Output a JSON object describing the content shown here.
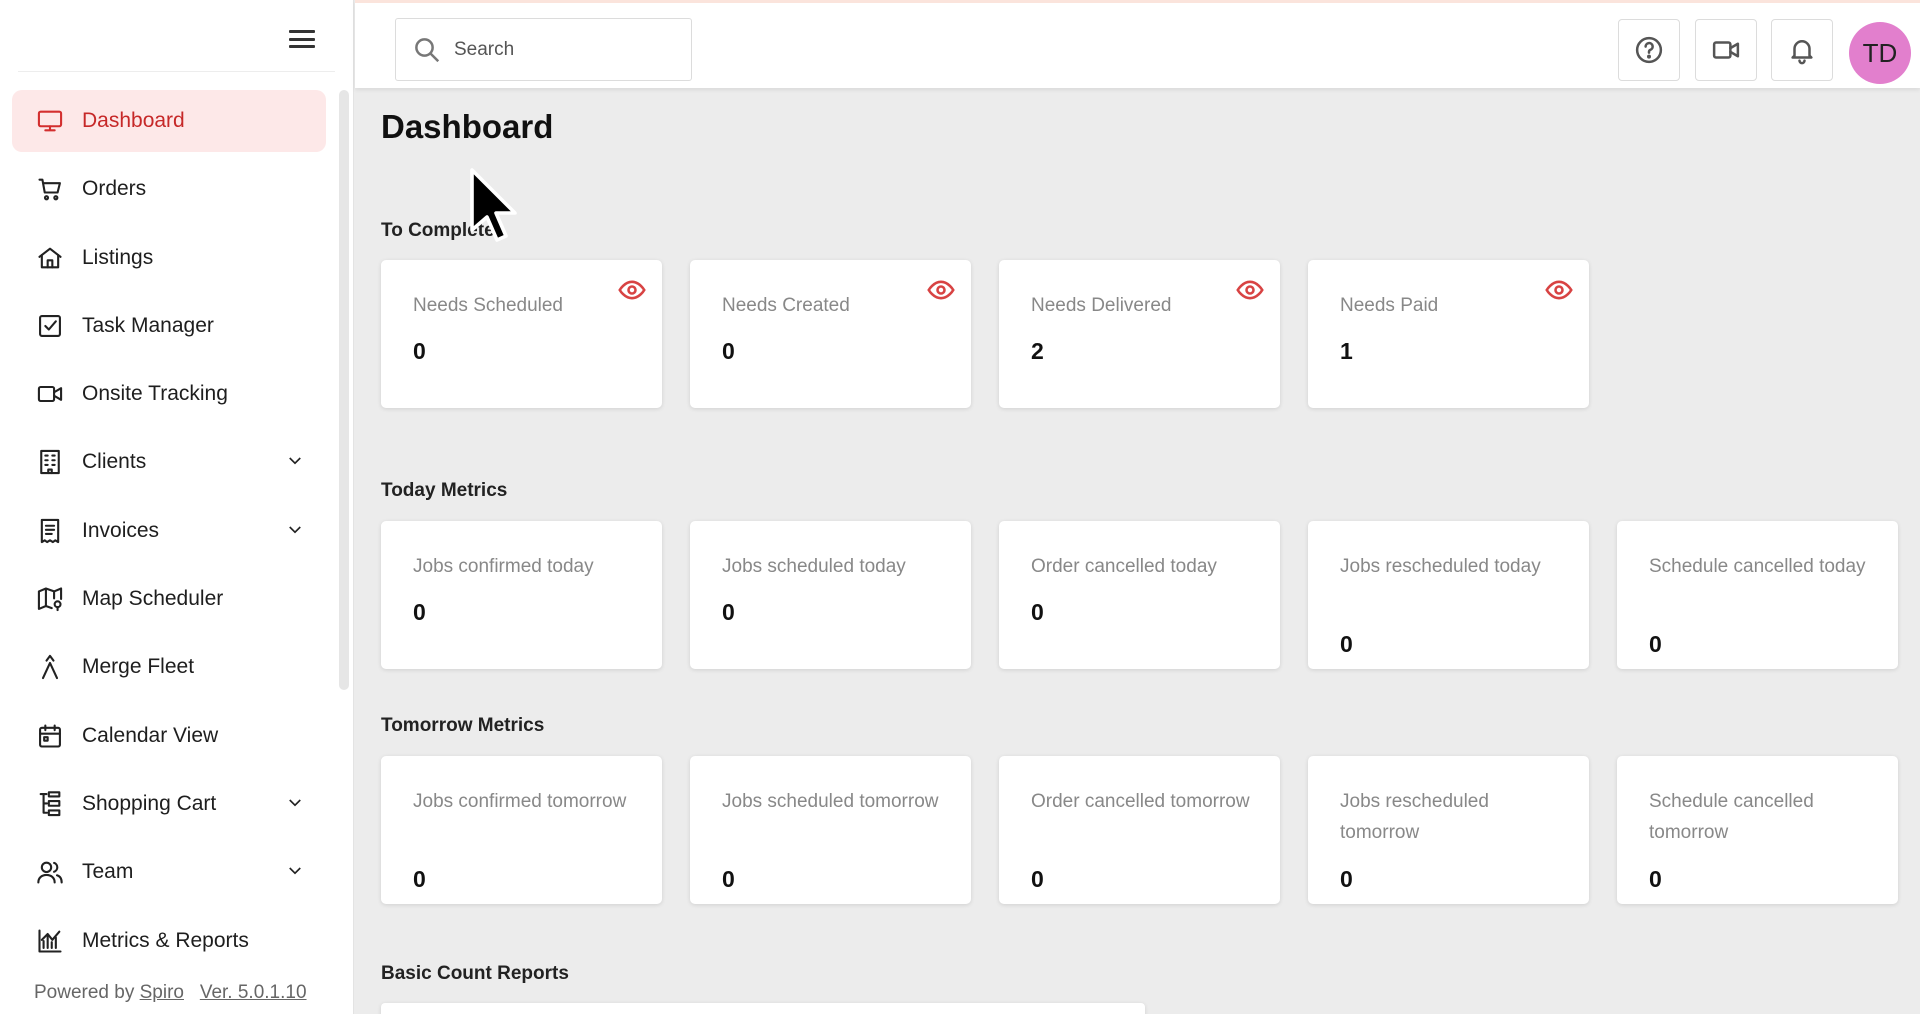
{
  "sidebar": {
    "items": [
      {
        "label": "Dashboard",
        "icon": "monitor-icon",
        "active": true
      },
      {
        "label": "Orders",
        "icon": "cart-icon"
      },
      {
        "label": "Listings",
        "icon": "home-icon"
      },
      {
        "label": "Task Manager",
        "icon": "checkbox-icon"
      },
      {
        "label": "Onsite Tracking",
        "icon": "video-camera-icon"
      },
      {
        "label": "Clients",
        "icon": "building-icon",
        "expandable": true
      },
      {
        "label": "Invoices",
        "icon": "receipt-icon",
        "expandable": true
      },
      {
        "label": "Map Scheduler",
        "icon": "map-icon"
      },
      {
        "label": "Merge Fleet",
        "icon": "merge-icon"
      },
      {
        "label": "Calendar View",
        "icon": "calendar-icon"
      },
      {
        "label": "Shopping Cart",
        "icon": "hierarchy-icon",
        "expandable": true
      },
      {
        "label": "Team",
        "icon": "users-icon",
        "expandable": true
      },
      {
        "label": "Metrics & Reports",
        "icon": "chart-icon"
      }
    ],
    "footer": {
      "powered_by": "Powered by",
      "brand": "Spiro",
      "version": "Ver. 5.0.1.10"
    }
  },
  "topbar": {
    "search_placeholder": "Search",
    "avatar_initials": "TD",
    "avatar_color": "#e27fcd"
  },
  "main": {
    "title": "Dashboard",
    "sections": [
      {
        "title": "To Complete",
        "cards": [
          {
            "label": "Needs Scheduled",
            "value": "0"
          },
          {
            "label": "Needs Created",
            "value": "0"
          },
          {
            "label": "Needs Delivered",
            "value": "2"
          },
          {
            "label": "Needs Paid",
            "value": "1"
          }
        ]
      },
      {
        "title": "Today Metrics",
        "cards": [
          {
            "label": "Jobs confirmed today",
            "value": "0"
          },
          {
            "label": "Jobs scheduled today",
            "value": "0"
          },
          {
            "label": "Order cancelled today",
            "value": "0"
          },
          {
            "label": "Jobs rescheduled today",
            "value": "0"
          },
          {
            "label": "Schedule cancelled today",
            "value": "0"
          }
        ]
      },
      {
        "title": "Tomorrow Metrics",
        "cards": [
          {
            "label": "Jobs confirmed tomorrow",
            "value": "0"
          },
          {
            "label": "Jobs scheduled tomorrow",
            "value": "0"
          },
          {
            "label": "Order cancelled tomorrow",
            "value": "0"
          },
          {
            "label": "Jobs rescheduled tomorrow",
            "value": "0"
          },
          {
            "label": "Schedule cancelled tomorrow",
            "value": "0"
          }
        ]
      },
      {
        "title": "Basic Count Reports",
        "cards": []
      }
    ]
  },
  "colors": {
    "accent": "#d32f2f",
    "active_bg": "#fde8e8",
    "eye": "#d84343"
  }
}
